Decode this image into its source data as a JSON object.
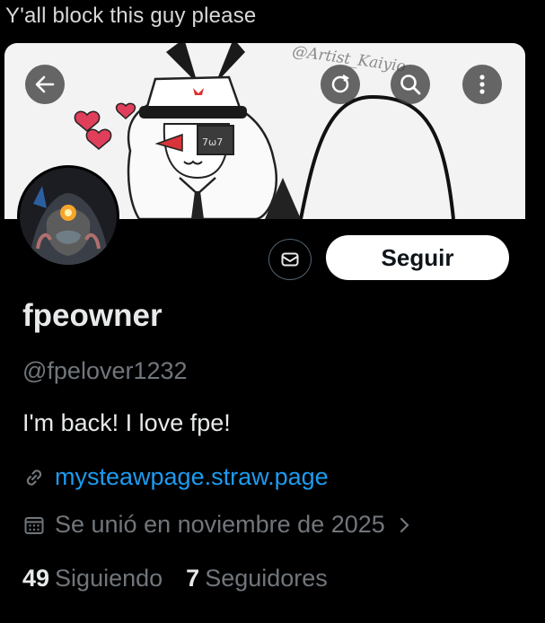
{
  "caption": "Y'all block this guy please",
  "banner": {
    "watermark": "@Artist_Kaiyio",
    "sign_text": "7ω7"
  },
  "actions": {
    "follow_label": "Seguir"
  },
  "profile": {
    "name": "fpeowner",
    "handle": "@fpelover1232",
    "bio": "I'm back! I love fpe!",
    "link": "mysteawpage.straw.page",
    "joined": "Se unió en noviembre de 2025"
  },
  "stats": {
    "following_count": "49",
    "following_label": "Siguiendo",
    "followers_count": "7",
    "followers_label": "Seguidores"
  },
  "colors": {
    "background": "#000000",
    "link": "#1d9bf0",
    "secondary_text": "#71767b",
    "primary_text": "#e7e9ea"
  },
  "icons": [
    "back-arrow-icon",
    "refresh-icon",
    "search-icon",
    "more-vertical-icon",
    "mail-icon",
    "link-icon",
    "calendar-icon",
    "chevron-right-icon"
  ]
}
